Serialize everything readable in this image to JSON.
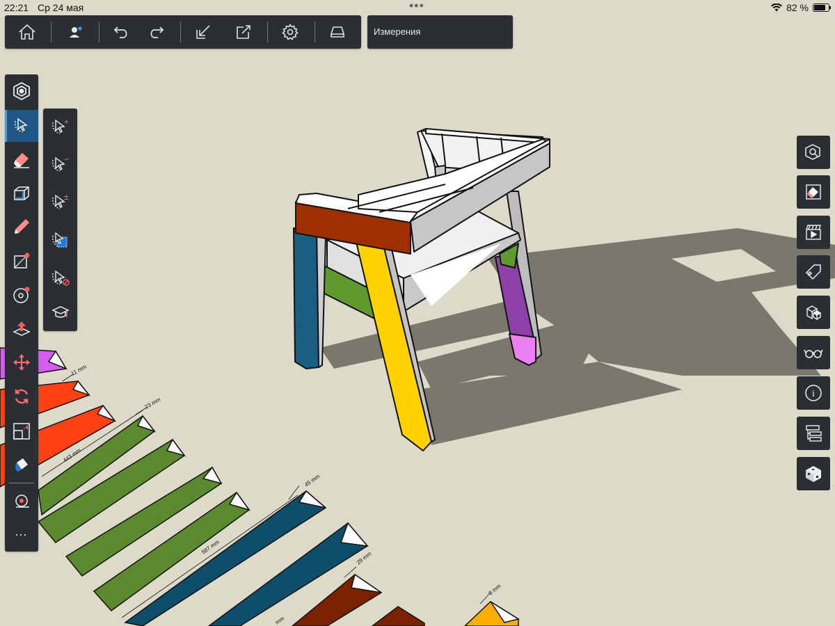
{
  "status_bar": {
    "time": "22:21",
    "date": "Ср 24 мая",
    "battery_percent": "82 %",
    "battery_level": 0.82
  },
  "top_toolbar": {
    "buttons": [
      {
        "name": "home-button",
        "icon": "home-icon"
      },
      {
        "name": "account-button",
        "icon": "user-add-icon"
      },
      {
        "name": "undo-button",
        "icon": "undo-icon"
      },
      {
        "name": "redo-button",
        "icon": "redo-icon"
      },
      {
        "name": "import-button",
        "icon": "import-icon"
      },
      {
        "name": "export-button",
        "icon": "export-icon"
      },
      {
        "name": "settings-button",
        "icon": "gear-icon"
      },
      {
        "name": "layout-button",
        "icon": "tray-icon"
      }
    ]
  },
  "instructor_panel": {
    "title": "Измерения"
  },
  "left_toolbar": {
    "tools": [
      "logo-icon",
      "select-icon",
      "eraser-icon",
      "box-icon",
      "pencil-icon",
      "rectangle-icon",
      "circle-icon",
      "push-pull-icon",
      "move-icon",
      "rotate-icon",
      "scale-icon",
      "paint-bucket-icon",
      "tape-measure-icon",
      "more-icon"
    ],
    "active_tool": "select-icon",
    "more_label": "⋯"
  },
  "select_flyout": {
    "tools": [
      "select-add-icon",
      "select-subtract-icon",
      "select-toggle-icon",
      "select-all-icon",
      "select-none-icon",
      "learn-icon"
    ],
    "add_sign": "+",
    "subtract_sign": "−",
    "toggle_sign": "±"
  },
  "right_toolbar": {
    "tools": [
      "search-components-icon",
      "object-info-icon",
      "scenes-icon",
      "tags-icon",
      "components-icon",
      "display-icon",
      "info-icon",
      "outliner-icon",
      "materials-icon"
    ],
    "info_label": "i"
  },
  "colors": {
    "background": "#dddac9",
    "panel": "#2b2e33",
    "active": "#1f5684",
    "accent": "#3ea3ff",
    "shadow": "#7a786c"
  },
  "dimension_labels": [
    "11 mm",
    "23 mm",
    "443 mm",
    "45 mm",
    "587 mm",
    "29 mm",
    "8 mm",
    "mm"
  ]
}
